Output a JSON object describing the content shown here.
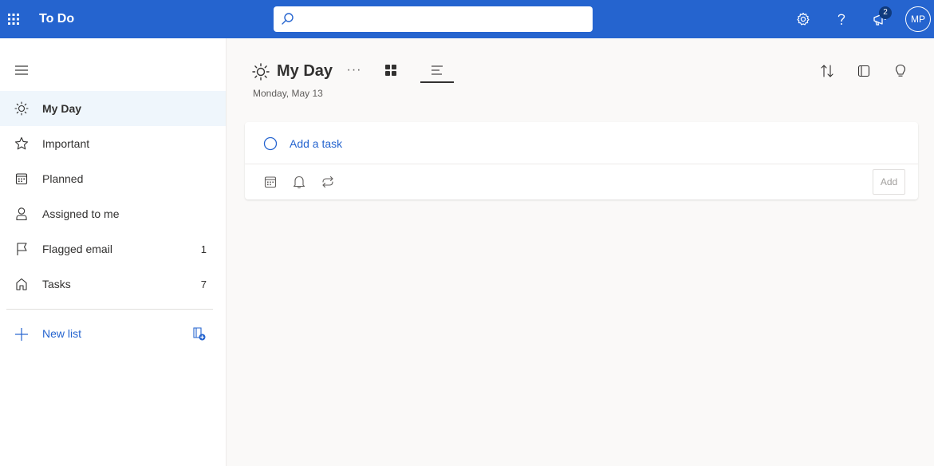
{
  "topbar": {
    "app_title": "To Do",
    "search_placeholder": "",
    "notifications_count": "2",
    "avatar_initials": "MP"
  },
  "sidebar": {
    "items": [
      {
        "label": "My Day",
        "icon": "sun-icon",
        "count": ""
      },
      {
        "label": "Important",
        "icon": "star-icon",
        "count": ""
      },
      {
        "label": "Planned",
        "icon": "calendar-icon",
        "count": ""
      },
      {
        "label": "Assigned to me",
        "icon": "person-icon",
        "count": ""
      },
      {
        "label": "Flagged email",
        "icon": "flag-icon",
        "count": "1"
      },
      {
        "label": "Tasks",
        "icon": "home-icon",
        "count": "7"
      }
    ],
    "new_list_label": "New list"
  },
  "main": {
    "title": "My Day",
    "more": "···",
    "date": "Monday, May 13",
    "add_task_placeholder": "Add a task",
    "add_button_label": "Add"
  },
  "colors": {
    "brand": "#2564cf",
    "active_nav_bg": "#eff6fc",
    "main_bg": "#faf9f8"
  }
}
